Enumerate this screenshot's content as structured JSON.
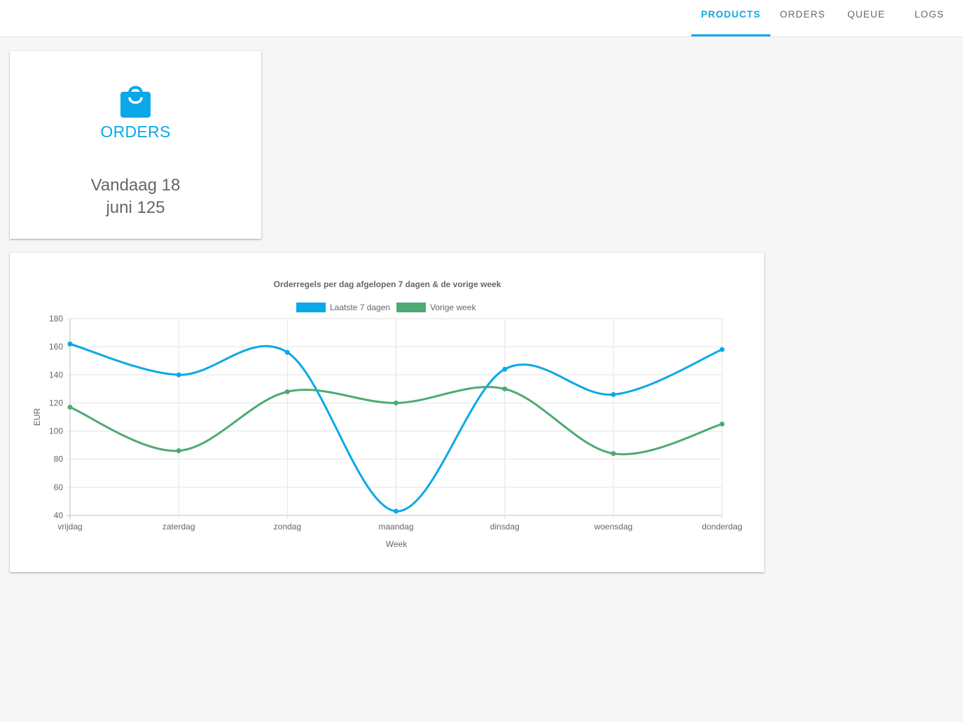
{
  "nav": {
    "tabs": [
      {
        "label": "PRODUCTS",
        "active": true
      },
      {
        "label": "ORDERS",
        "active": false
      },
      {
        "label": "QUEUE",
        "active": false
      },
      {
        "label": "LOGS",
        "active": false
      }
    ],
    "accent": "#0aa8e8"
  },
  "orders_card": {
    "icon": "shopping-bag-icon",
    "title": "ORDERS",
    "line1": "Vandaag 18",
    "line2": "juni 125"
  },
  "chart_data": {
    "type": "line",
    "title": "Orderregels per dag afgelopen 7 dagen & de vorige week",
    "xlabel": "Week",
    "ylabel": "EUR",
    "categories": [
      "vrijdag",
      "zaterdag",
      "zondag",
      "maandag",
      "dinsdag",
      "woensdag",
      "donderdag"
    ],
    "ylim": [
      40,
      180
    ],
    "yticks": [
      40,
      60,
      80,
      100,
      120,
      140,
      160,
      180
    ],
    "grid": true,
    "legend_position": "top",
    "series": [
      {
        "name": "Laatste 7 dagen",
        "color": "#0aa8e8",
        "values": [
          162,
          140,
          156,
          43,
          144,
          126,
          158
        ]
      },
      {
        "name": "Vorige week",
        "color": "#4caa72",
        "values": [
          117,
          86,
          128,
          120,
          130,
          84,
          105
        ]
      }
    ]
  }
}
